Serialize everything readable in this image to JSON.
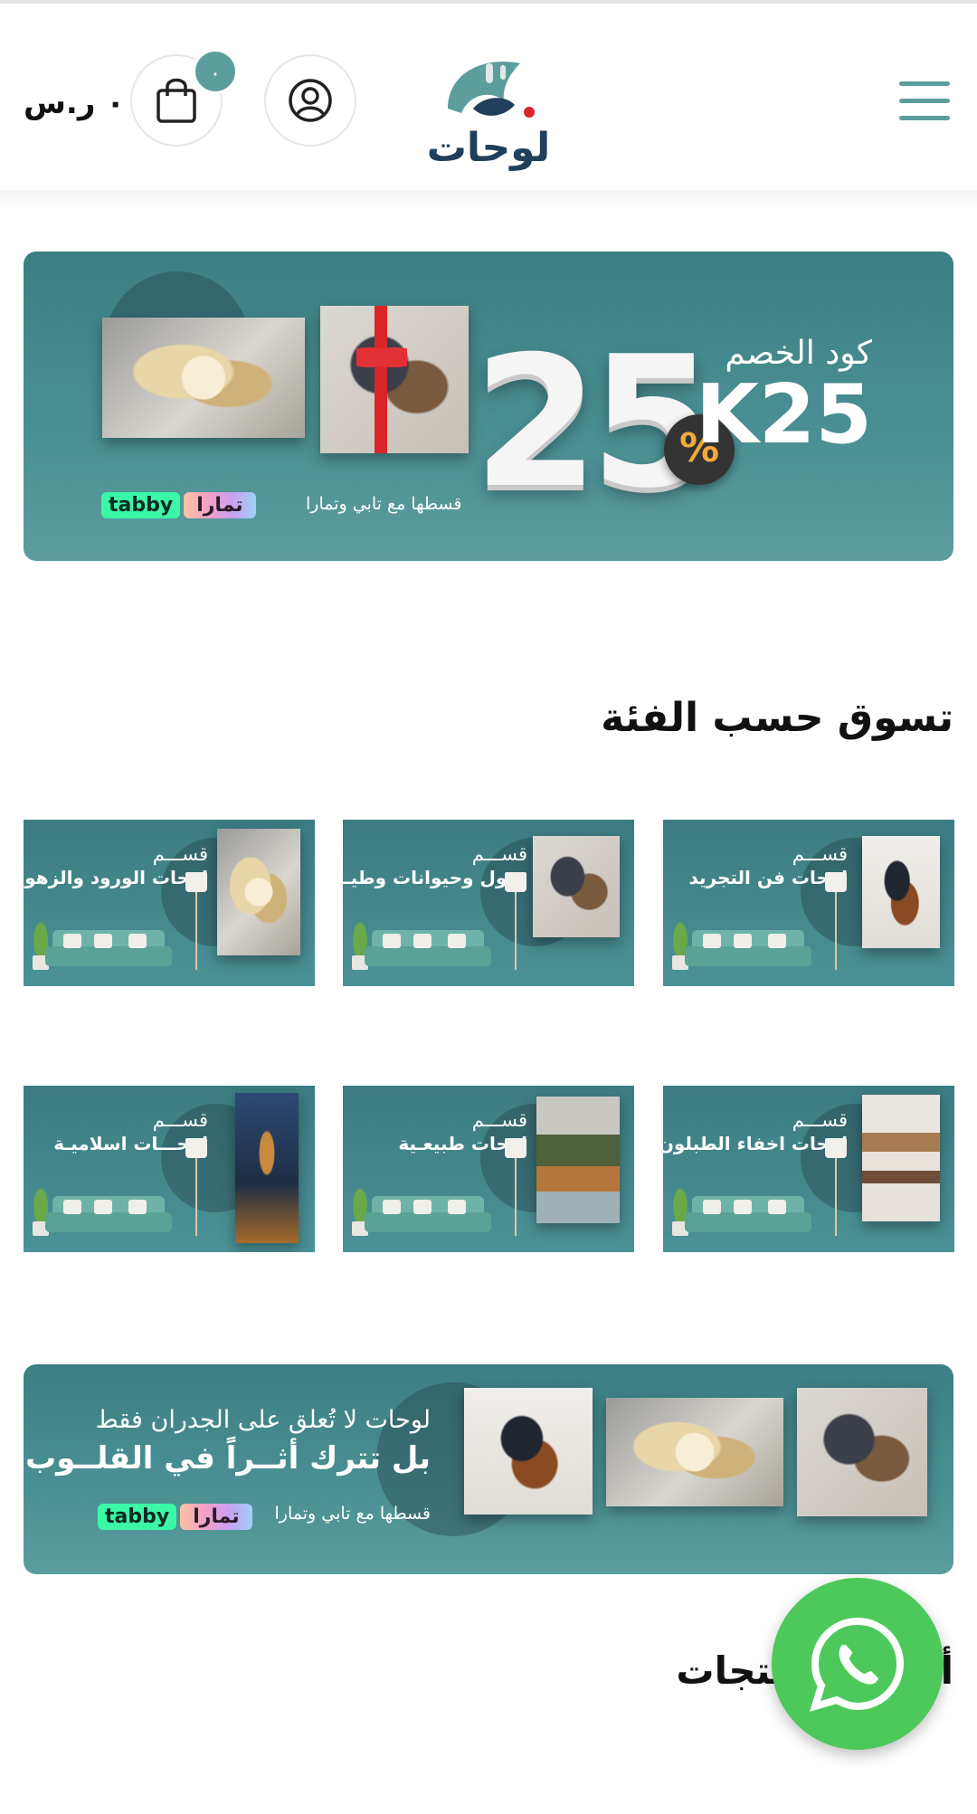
{
  "header": {
    "menu_icon": "hamburger-icon",
    "logo_text": "لوحات",
    "account_icon": "user-icon",
    "cart_icon": "shopping-bag-icon",
    "cart_count": "٠",
    "cart_total": "٠ ر.س"
  },
  "hero_banner": {
    "big_number": "25",
    "percent_sign": "%",
    "code_label": "كود الخصم",
    "code_value": "K25",
    "installment_text": "قسطها مع تابي وتمارا",
    "tabby": "tabby",
    "tamara": "تمارا"
  },
  "categories_section": {
    "title": "تسوق حسب الفئة",
    "items": [
      {
        "kicker": "قســـم",
        "label": "لوحات فن التجريد"
      },
      {
        "kicker": "قســـم",
        "label": "خيول وحيوانات وطيـور"
      },
      {
        "kicker": "قســـم",
        "label": "لوحات الورود والزهور"
      },
      {
        "kicker": "قســـم",
        "label": "لوحات اخفاء الطبلون"
      },
      {
        "kicker": "قســـم",
        "label": "لوحات طبيعـية"
      },
      {
        "kicker": "قســـم",
        "label": "لوحـــات اسلاميـة"
      }
    ]
  },
  "promo_banner": {
    "line1": "لوحات لا تُعلق على الجدران فقط",
    "line2": "بل تترك أثــراً في القلــوب",
    "installment_text": "قسطها مع تابي وتمارا",
    "tabby": "tabby",
    "tamara": "تمارا"
  },
  "products_section": {
    "title": "أحدث المنتجات"
  },
  "whatsapp": {
    "icon": "whatsapp-icon",
    "color": "#4cc95a"
  },
  "colors": {
    "brand": "#5b9e9c",
    "banner_teal": "#3c7f84"
  }
}
